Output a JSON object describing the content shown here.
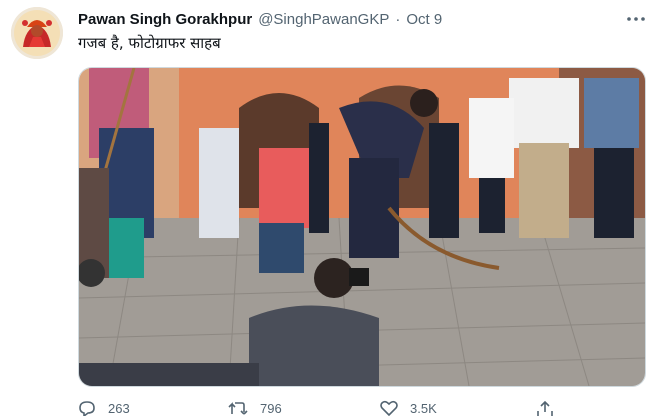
{
  "author": {
    "name": "Pawan Singh Gorakhpur",
    "handle": "@SinghPawanGKP",
    "separator": "·",
    "date": "Oct 9"
  },
  "tweet": {
    "text": "गजब है, फोटोग्राफर साहब"
  },
  "media": {
    "description_icon": "photo"
  },
  "actions": {
    "reply_count": "263",
    "retweet_count": "796",
    "like_count": "3.5K"
  },
  "colors": {
    "text_primary": "#0f1419",
    "text_secondary": "#536471",
    "border": "#cfd9de"
  },
  "icons": [
    "more-icon",
    "reply-icon",
    "retweet-icon",
    "like-icon",
    "share-icon"
  ]
}
